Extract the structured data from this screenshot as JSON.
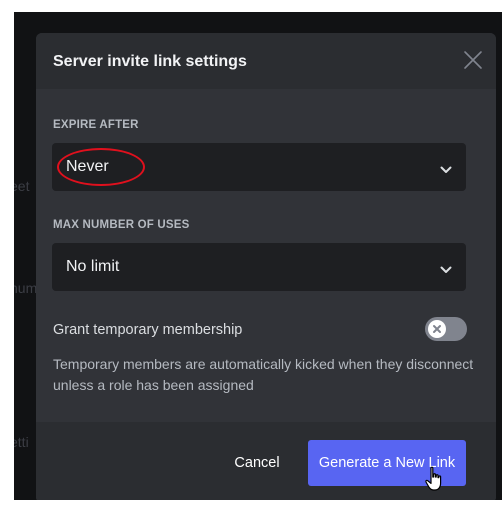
{
  "modal": {
    "title": "Server invite link settings",
    "close_icon": "close-icon"
  },
  "expire": {
    "label": "EXPIRE AFTER",
    "value": "Never",
    "icon": "chevron-down-icon"
  },
  "max_uses": {
    "label": "MAX NUMBER OF USES",
    "value": "No limit",
    "icon": "chevron-down-icon"
  },
  "temporary": {
    "label": "Grant temporary membership",
    "toggle_on": false,
    "description": "Temporary members are automatically kicked when they disconnect unless a role has been assigned"
  },
  "footer": {
    "cancel_label": "Cancel",
    "generate_label": "Generate a New Link"
  },
  "background": {
    "fragments": [
      "eet",
      "num",
      "etti"
    ]
  },
  "colors": {
    "accent": "#5865f2",
    "annotation": "#e0101d",
    "modal_bg": "#313338",
    "input_bg": "#1e1f22"
  }
}
